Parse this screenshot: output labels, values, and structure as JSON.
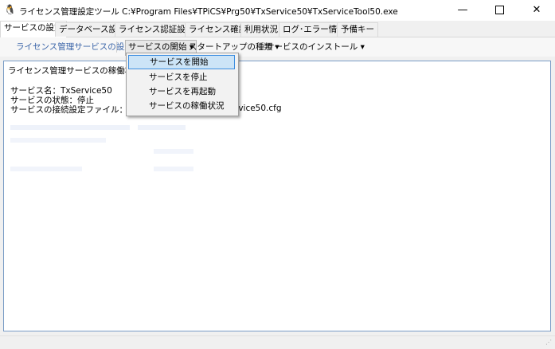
{
  "window": {
    "title": "ライセンス管理設定ツール  C:¥Program Files¥TPiCS¥Prg50¥TxService50¥TxServiceTool50.exe",
    "minimize": "—",
    "close": "✕"
  },
  "tabs": [
    {
      "label": "サービスの設定"
    },
    {
      "label": "データベース設定"
    },
    {
      "label": "ライセンス認証設定"
    },
    {
      "label": "ライセンス確認"
    },
    {
      "label": "利用状況"
    },
    {
      "label": "ログ･エラー情報"
    },
    {
      "label": "予備キー"
    }
  ],
  "toolbar": {
    "service_settings": "ライセンス管理サービスの設定",
    "start_service": "サービスの開始",
    "startup_type": "スタートアップの種類",
    "install_service": "サービスのインストール",
    "caret": "▾"
  },
  "dropdown": {
    "items": [
      {
        "label": "サービスを開始"
      },
      {
        "label": "サービスを停止"
      },
      {
        "label": "サービスを再起動"
      },
      {
        "label": "サービスの稼働状況"
      }
    ]
  },
  "panel": {
    "heading": "ライセンス管理サービスの稼働状況",
    "service_name": "サービス名：TxService50",
    "service_status": "サービスの状態：停止",
    "config_file_prefix": "サービスの接続設定ファイル：C:¥TPi",
    "config_file_suffix": "rvice50.cfg"
  }
}
